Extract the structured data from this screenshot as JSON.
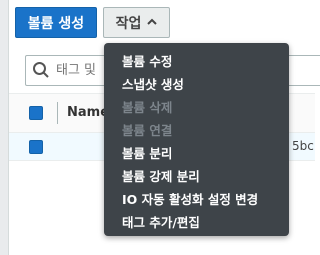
{
  "toolbar": {
    "create_volume_label": "볼륨 생성",
    "actions_label": "작업"
  },
  "search": {
    "placeholder": "태그 및"
  },
  "table": {
    "columns": [
      "Name"
    ],
    "rows": [
      {
        "id_tail": "5bc",
        "selected": true
      }
    ]
  },
  "actions_menu": {
    "items": [
      {
        "label": "볼륨 수정",
        "enabled": true
      },
      {
        "label": "스냅샷 생성",
        "enabled": true
      },
      {
        "label": "볼륨 삭제",
        "enabled": false
      },
      {
        "label": "볼륨 연결",
        "enabled": false
      },
      {
        "label": "볼륨 분리",
        "enabled": true
      },
      {
        "label": "볼륨 강제 분리",
        "enabled": true
      },
      {
        "label": "IO 자동 활성화 설정 변경",
        "enabled": true
      },
      {
        "label": "태그 추가/편집",
        "enabled": true
      }
    ]
  },
  "colors": {
    "primary": "#1a73c9",
    "menu_bg": "#3e4449",
    "menu_disabled": "#7d858c"
  }
}
